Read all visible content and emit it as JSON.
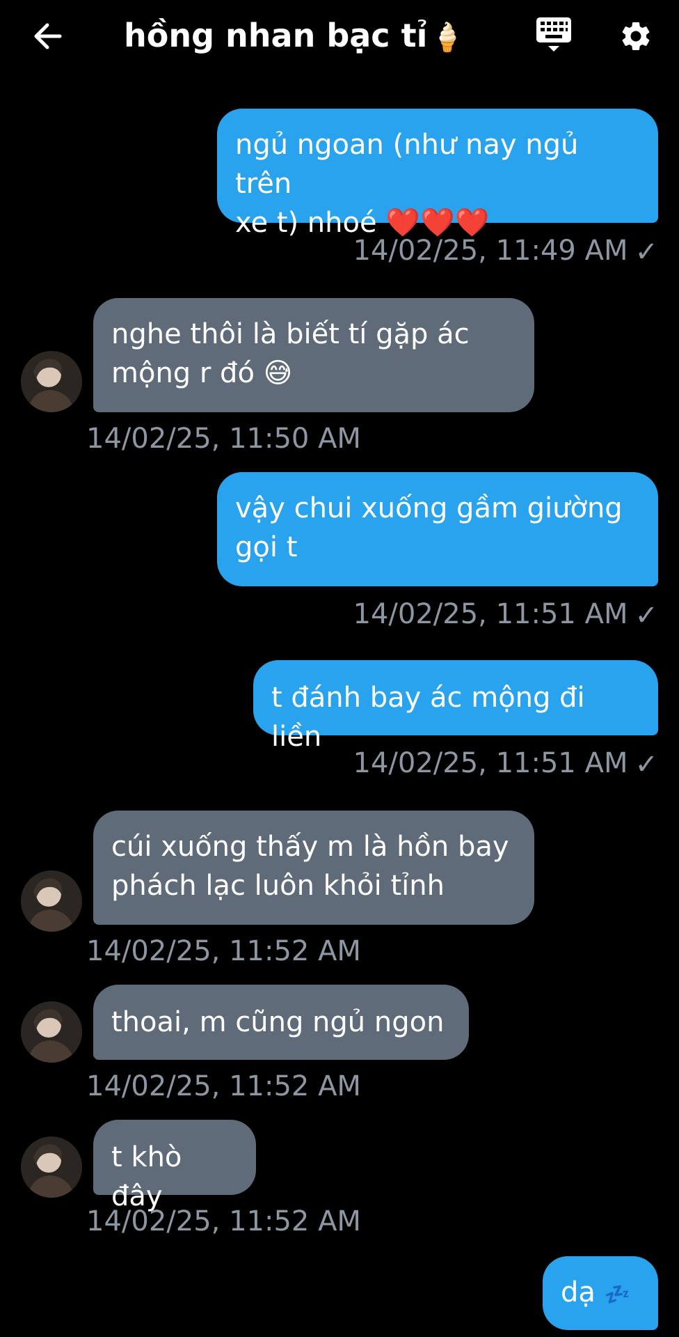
{
  "header": {
    "title": "hồng nhan bạc tỉ",
    "title_emoji": "🍦",
    "back_icon": "arrow-left-icon",
    "keyboard_icon": "keyboard-icon",
    "settings_icon": "gear-icon"
  },
  "colors": {
    "sent_bubble": "#2aa3ef",
    "received_bubble": "#5f6b78",
    "timestamp": "#8d97a3",
    "background": "#000000"
  },
  "messages": [
    {
      "direction": "sent",
      "text": "ngủ ngoan (như nay ngủ trên\nxe t) nhoé",
      "emoji": "❤️❤️❤️",
      "timestamp": "14/02/25, 11:49 AM",
      "status": "✓"
    },
    {
      "direction": "received",
      "text": "nghe thôi là biết tí gặp ác\nmộng r đó",
      "emoji": "😅",
      "timestamp": "14/02/25, 11:50 AM"
    },
    {
      "direction": "sent",
      "text": "vậy chui xuống gầm giường\ngọi t",
      "timestamp": "14/02/25, 11:51 AM",
      "status": "✓"
    },
    {
      "direction": "sent",
      "text": "t đánh bay ác mộng đi liền",
      "timestamp": "14/02/25, 11:51 AM",
      "status": "✓"
    },
    {
      "direction": "received",
      "text": "cúi xuống thấy m là hồn bay\nphách lạc luôn khỏi tỉnh",
      "timestamp": "14/02/25, 11:52 AM"
    },
    {
      "direction": "received",
      "text": "thoai, m cũng ngủ ngon",
      "timestamp": "14/02/25, 11:52 AM"
    },
    {
      "direction": "received",
      "text": "t khò đây",
      "timestamp": "14/02/25, 11:52 AM"
    },
    {
      "direction": "sent",
      "text": "dạ",
      "emoji": "💤"
    }
  ]
}
